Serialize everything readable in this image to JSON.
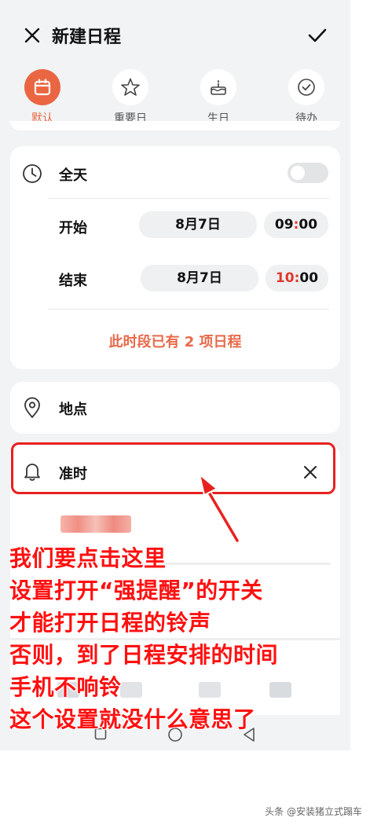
{
  "header": {
    "title": "新建日程",
    "close_icon": "close-icon",
    "confirm_icon": "check-icon"
  },
  "types": [
    {
      "label": "默认",
      "icon": "calendar-icon",
      "active": true
    },
    {
      "label": "重要日",
      "icon": "star-icon",
      "active": false
    },
    {
      "label": "生日",
      "icon": "cake-icon",
      "active": false
    },
    {
      "label": "待办",
      "icon": "check-circle-icon",
      "active": false
    }
  ],
  "time_card": {
    "all_day_label": "全天",
    "all_day_on": false,
    "start_label": "开始",
    "start_date": "8月7日",
    "start_hour": "09",
    "start_minute": "00",
    "end_label": "结束",
    "end_date": "8月7日",
    "end_hour": "10",
    "end_minute": "00",
    "conflict_text": "此时段已有 2 项日程"
  },
  "location": {
    "label": "地点"
  },
  "reminder": {
    "label": "准时"
  },
  "annotation": {
    "lines": [
      "我们要点击这里",
      "设置打开“强提醒”的开关",
      "才能打开日程的铃声",
      "否则，到了日程安排的时间",
      "手机不响铃",
      "这个设置就没什么意思了"
    ]
  },
  "watermark": "头条 @安装猪立式蹋车",
  "colors": {
    "accent": "#ea6642",
    "annotation_red": "#ff1010",
    "highlight_red": "#e8211f",
    "time_red": "#e0392b"
  }
}
